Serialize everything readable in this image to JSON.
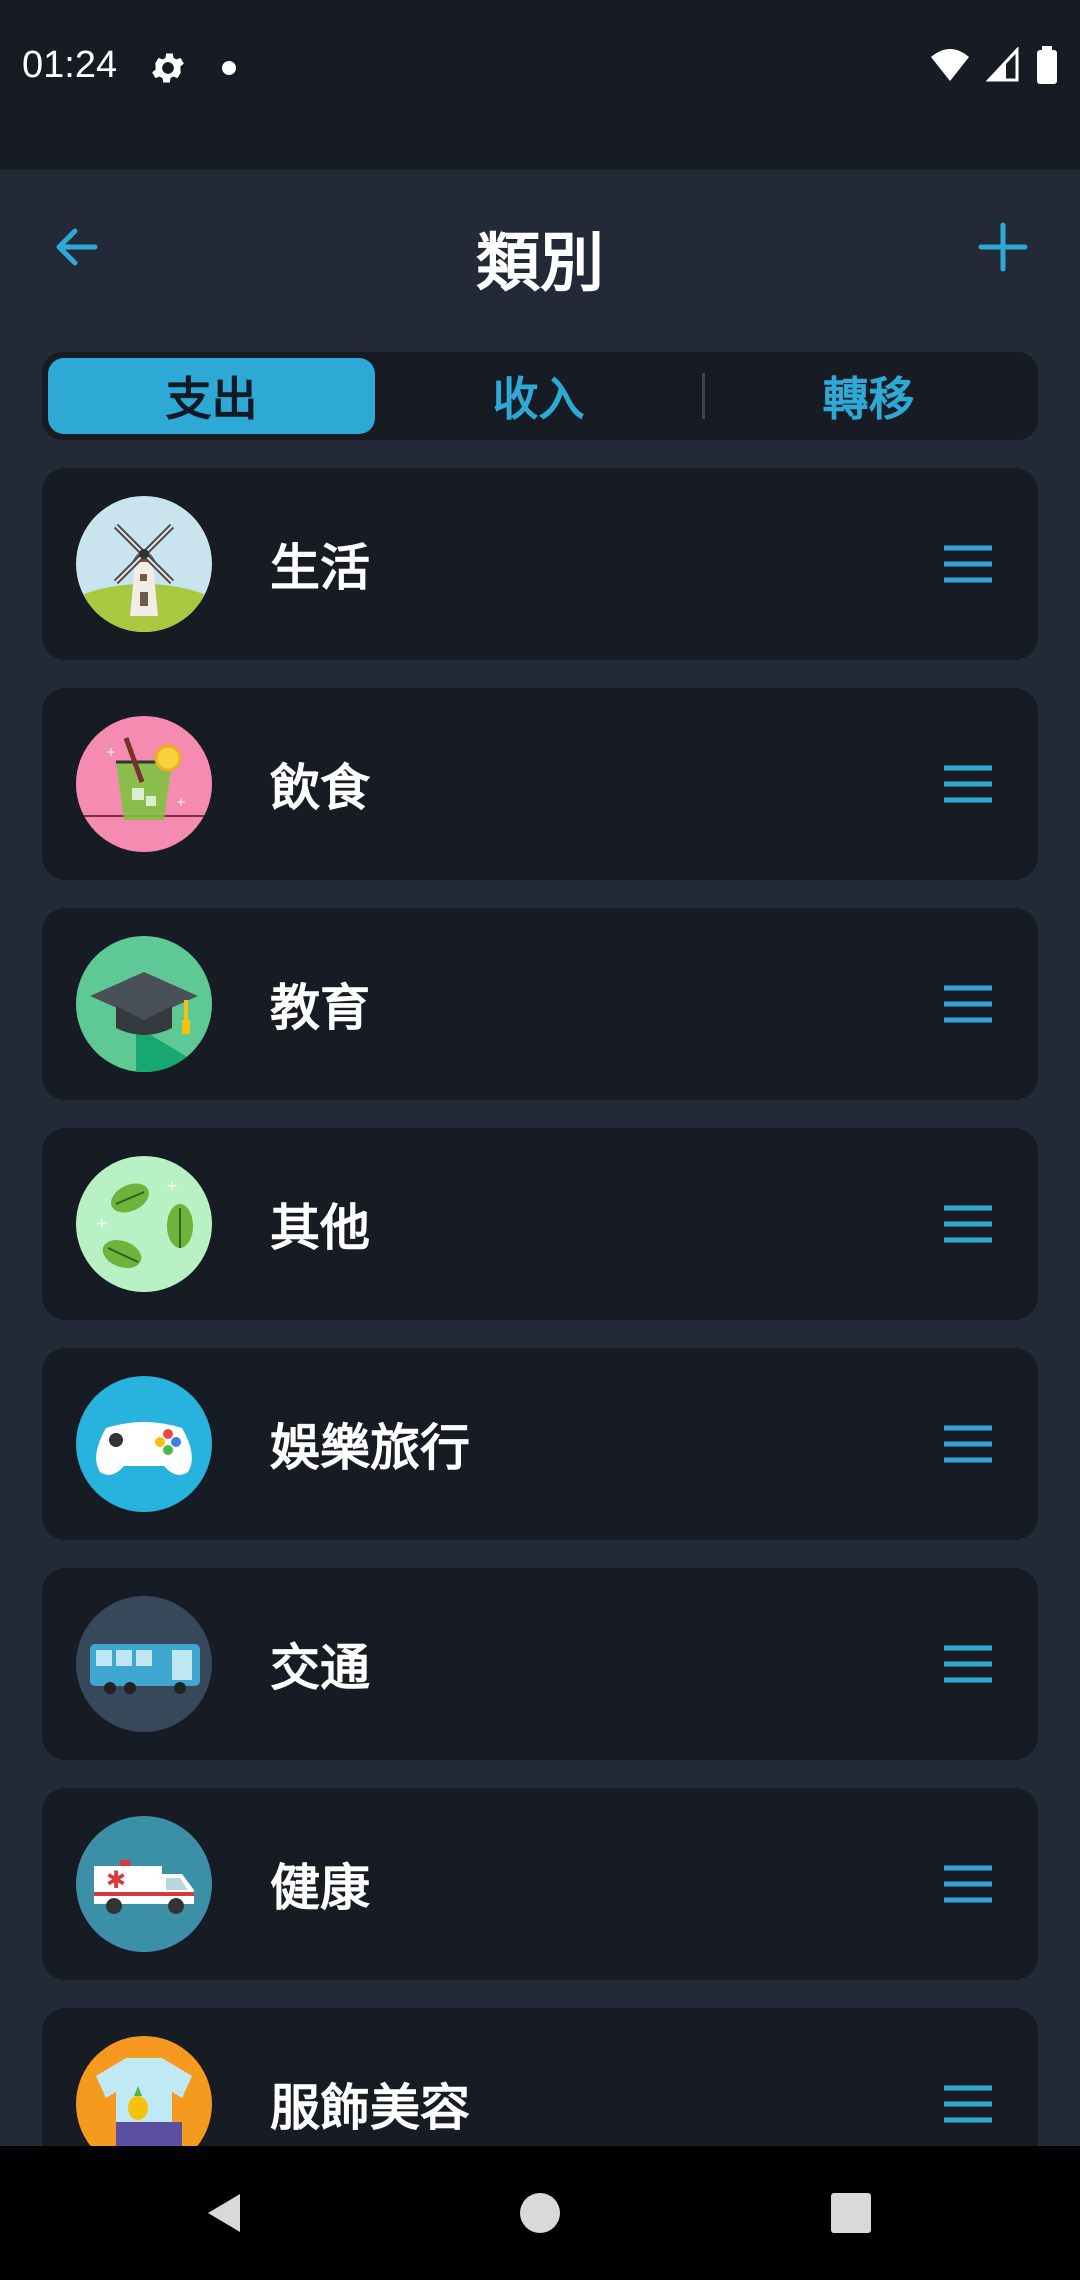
{
  "status": {
    "time": "01:24"
  },
  "header": {
    "title": "類別"
  },
  "tabs": [
    {
      "label": "支出",
      "active": true
    },
    {
      "label": "收入",
      "active": false
    },
    {
      "label": "轉移",
      "active": false
    }
  ],
  "categories": [
    {
      "label": "生活",
      "icon": "windmill-icon"
    },
    {
      "label": "飲食",
      "icon": "drink-icon"
    },
    {
      "label": "教育",
      "icon": "graduation-cap-icon"
    },
    {
      "label": "其他",
      "icon": "leaves-icon"
    },
    {
      "label": "娛樂旅行",
      "icon": "gamepad-icon"
    },
    {
      "label": "交通",
      "icon": "bus-icon"
    },
    {
      "label": "健康",
      "icon": "ambulance-icon"
    },
    {
      "label": "服飾美容",
      "icon": "clothing-icon"
    }
  ],
  "colors": {
    "accent": "#2ea9d6",
    "background": "#232936",
    "card": "#171b23"
  }
}
